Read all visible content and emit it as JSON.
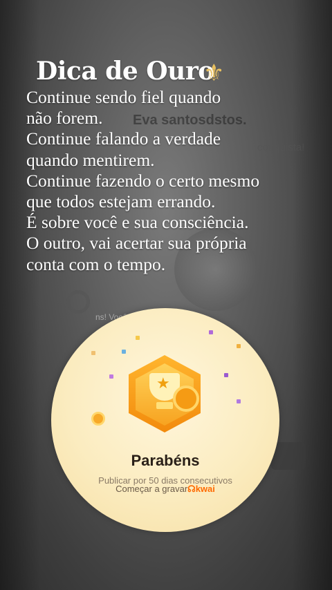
{
  "tip": {
    "title": "Dica de Ouro",
    "title_icon": "fleur-de-lis-icon",
    "lines": [
      "Continue sendo fiel quando",
      "não forem.",
      "Continue falando a verdade",
      "quando mentirem.",
      "Continue fazendo o certo mesmo",
      "que todos estejam errando.",
      "É sobre você e sua consciência.",
      "O outro, vai acertar sua própria",
      "conta com o tempo."
    ]
  },
  "background": {
    "username": "Eva santosdstos.",
    "conquista_fragment": "conquista!",
    "achievement_fragment": "ns! Você conseguiu uma nova"
  },
  "badge": {
    "title": "Parabéns",
    "subtitle": "Publicar por 50 dias consecutivos",
    "record_prefix": "Começar a gravar",
    "brand": "kwai",
    "brand_icon": "kwai-logo-icon"
  },
  "colors": {
    "gold": "#f7a320",
    "brand_orange": "#ff6a00"
  }
}
